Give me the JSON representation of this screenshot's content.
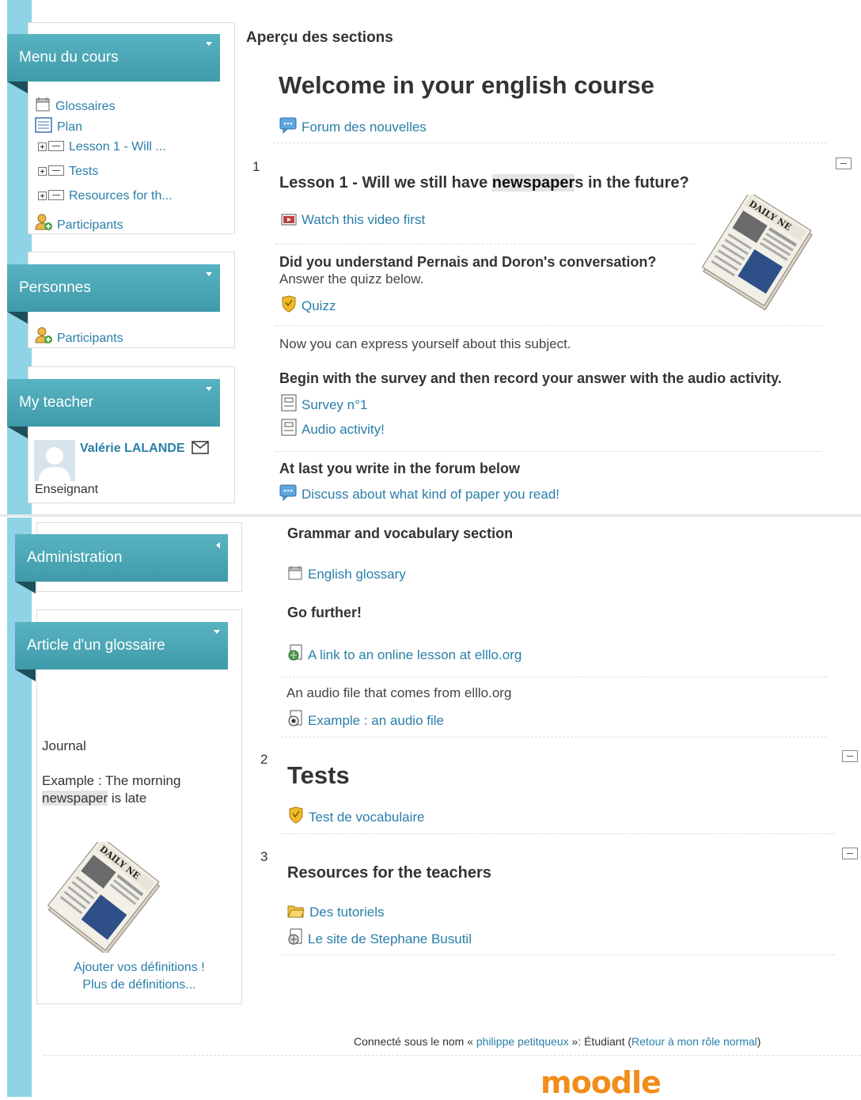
{
  "top_panel": {
    "section_overview_title": "Aperçu des sections",
    "course_title": "Welcome in your english course",
    "news_forum": "Forum des nouvelles",
    "section1": {
      "number": "1",
      "title_before": "Lesson 1 - Will we still have ",
      "title_highlight": "newspaper",
      "title_after": "s in the future?",
      "video_link": "Watch this video first",
      "question": "Did you understand Pernais and Doron's conversation?",
      "instruction": "Answer the quizz below.",
      "quiz_link": "Quizz",
      "express_text": "Now you can express yourself about this subject.",
      "survey_instruction": "Begin with the survey and then record your answer with the audio activity.",
      "survey_link": "Survey n°1",
      "audio_link": "Audio activity!",
      "forum_heading": "At last you write in the forum below",
      "forum_link": "Discuss about what kind of paper you read!"
    }
  },
  "sidebar_top": {
    "course_menu": {
      "title": "Menu du cours",
      "items": [
        "Glossaires",
        "Plan",
        "Lesson 1 - Will ...",
        "Tests",
        "Resources for th...",
        "Participants"
      ]
    },
    "people": {
      "title": "Personnes",
      "items": [
        "Participants"
      ]
    },
    "teacher": {
      "title": "My teacher",
      "name": "Valérie LALANDE",
      "role": "Enseignant"
    }
  },
  "sidebar_bottom": {
    "administration": {
      "title": "Administration"
    },
    "glossary_entry": {
      "title": "Article d'un glossaire",
      "term": "Journal",
      "example_prefix": "Example : The morning",
      "example_highlight": "newspaper",
      "example_suffix": " is late",
      "add_definitions": "Ajouter vos définitions !",
      "more_definitions": "Plus de définitions..."
    }
  },
  "bottom_panel": {
    "grammar_heading": "Grammar and vocabulary section",
    "glossary_link": "English glossary",
    "further_heading": "Go further!",
    "ellio_link": "A link to an online lesson at elllo.org",
    "audio_text": "An audio file that comes from elllo.org",
    "audio_example_link": "Example : an audio file",
    "section2": {
      "number": "2",
      "title": "Tests",
      "link": "Test de vocabulaire"
    },
    "section3": {
      "number": "3",
      "title": "Resources for the teachers",
      "tutorials_link": "Des tutoriels",
      "site_link": "Le site de Stephane Busutil"
    },
    "footer": {
      "logged_prefix": "Connecté sous le nom « ",
      "user": "philippe petitqueux",
      "logged_mid": " »: Étudiant (",
      "return_link": "Retour à mon rôle normal",
      "logged_suffix": ")",
      "logo": "moodle"
    }
  },
  "colors": {
    "block_header": "#4aa6b5",
    "link": "#2a7fa8",
    "stripe": "#8ed3e6"
  }
}
